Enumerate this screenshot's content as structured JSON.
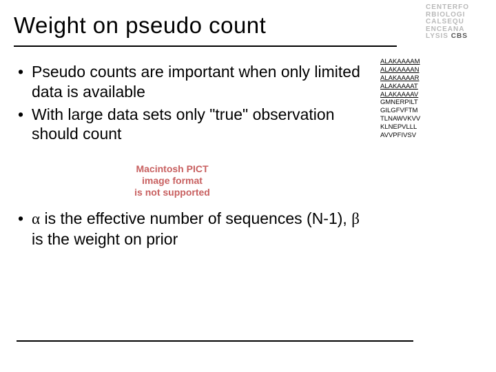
{
  "title": "Weight on pseudo count",
  "logo": {
    "l1": "CENTERFO",
    "l2": "RBIOLOGI",
    "l3": "CALSEQU",
    "l4": "ENCEANA",
    "l5a": "LYSIS",
    "l5b": "CBS"
  },
  "bullets": {
    "b1": "Pseudo counts are important when only limited data is available",
    "b2": "With large data sets only \"true\" observation should count",
    "b3a": "α",
    "b3b": " is the effective number of sequences (N-1), ",
    "b3c": "β",
    "b3d": " is the weight on prior"
  },
  "pict": {
    "l1": "Macintosh PICT",
    "l2": "image format",
    "l3": "is not supported"
  },
  "seq": {
    "s1": "ALAKAAAAM",
    "s2": "ALAKAAAAN",
    "s3": "ALAKAAAAR",
    "s4": "ALAKAAAAT",
    "s5": "ALAKAAAAV",
    "s6": "GMNERPILT",
    "s7": "GILGFVFTM",
    "s8": "TLNAWVKVV",
    "s9": "KLNEPVLLL",
    "s10": "AVVPFIVSV"
  }
}
